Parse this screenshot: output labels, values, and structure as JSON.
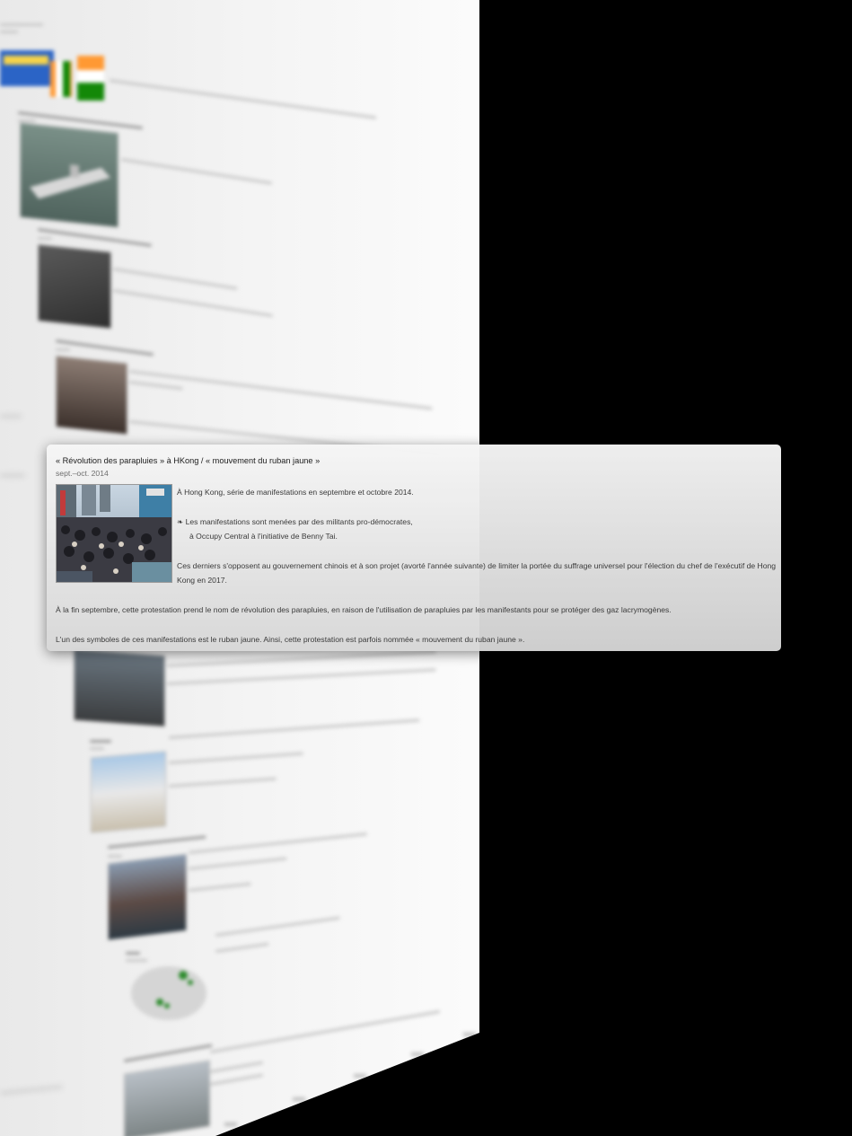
{
  "card": {
    "title": "« Révolution des parapluies » à HKong / « mouvement du ruban jaune »",
    "date": "sept.–oct. 2014",
    "p1": "À Hong Kong, série de manifestations en septembre et octobre 2014.",
    "p2_line1": "❧ Les manifestations sont menées par des militants pro-démocrates,",
    "p2_line2": "à Occupy Central à l'initiative de Benny Tai.",
    "p3_line1": "Ces derniers s'opposent au gouvernement chinois et à son projet (avorté l'année suivante) de limiter la portée du suffrage universel pour l'élection du chef de l'exécutif de Hong",
    "p3_line2": "Kong en 2017.",
    "p4": "À la fin septembre, cette protestation prend le nom de révolution des parapluies, en raison de l'utilisation de parapluies par les manifestants pour se protéger des gaz lacrymogènes.",
    "p5": "L'un des symboles de ces manifestations est le ruban jaune. Ainsi, cette protestation est parfois nommée « mouvement du ruban jaune ».",
    "photo_icon": "crowd-umbrellas-photo"
  },
  "colors": {
    "background": "#000000",
    "card_top": "#f5f5f5",
    "card_bottom": "#d6d6d6",
    "card_title": "#1c1c1c",
    "card_text": "#3a3a3a"
  }
}
